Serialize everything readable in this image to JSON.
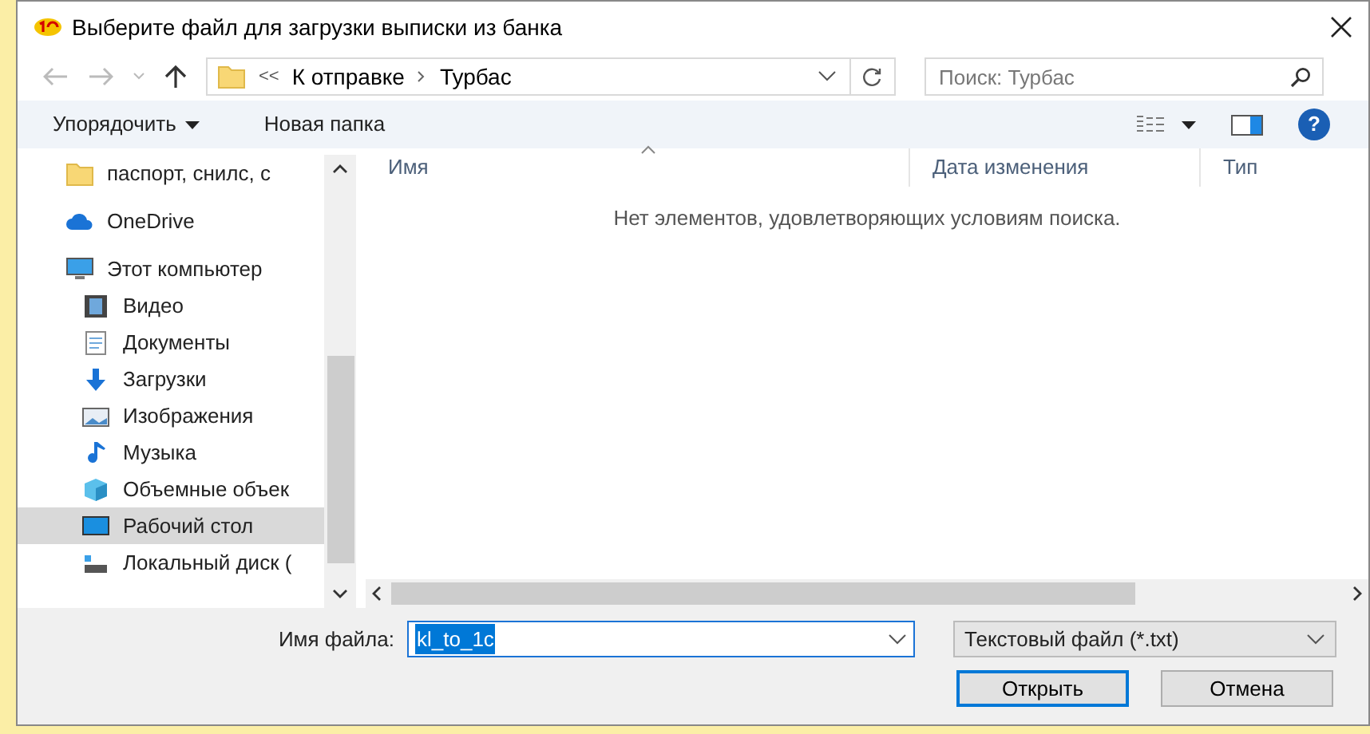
{
  "window": {
    "title": "Выберите файл для загрузки выписки из банка"
  },
  "address": {
    "overflow": "<<",
    "crumbs": [
      "К отправке",
      "Турбас"
    ]
  },
  "search": {
    "placeholder": "Поиск: Турбас"
  },
  "toolbar": {
    "organize": "Упорядочить",
    "new_folder": "Новая папка",
    "help": "?"
  },
  "sidebar": {
    "items": [
      {
        "label": "паспорт, снилс, с",
        "kind": "folder",
        "selected": false
      },
      {
        "label": "OneDrive",
        "kind": "cloud",
        "selected": false
      },
      {
        "label": "Этот компьютер",
        "kind": "pc",
        "selected": false,
        "children": [
          {
            "label": "Видео",
            "kind": "video",
            "selected": false
          },
          {
            "label": "Документы",
            "kind": "docs",
            "selected": false
          },
          {
            "label": "Загрузки",
            "kind": "downloads",
            "selected": false
          },
          {
            "label": "Изображения",
            "kind": "pictures",
            "selected": false
          },
          {
            "label": "Музыка",
            "kind": "music",
            "selected": false
          },
          {
            "label": "Объемные объек",
            "kind": "objects3d",
            "selected": false
          },
          {
            "label": "Рабочий стол",
            "kind": "desktop",
            "selected": true
          },
          {
            "label": "Локальный диск (",
            "kind": "disk",
            "selected": false
          }
        ]
      }
    ]
  },
  "table": {
    "columns": [
      "Имя",
      "Дата изменения",
      "Тип"
    ],
    "empty_message": "Нет элементов, удовлетворяющих условиям поиска."
  },
  "footer": {
    "filename_label": "Имя файла:",
    "filename": "kl_to_1c",
    "filetype": "Текстовый файл (*.txt)",
    "buttons": [
      "Открыть",
      "Отмена"
    ]
  }
}
